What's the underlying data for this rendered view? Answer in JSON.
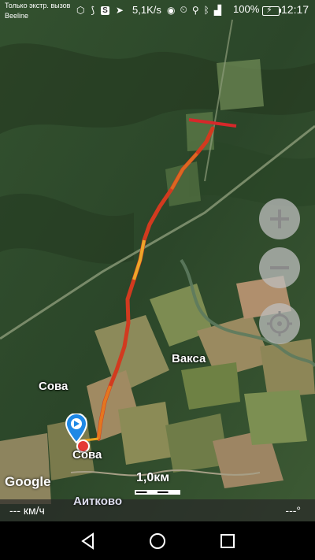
{
  "status_bar": {
    "carrier_line1": "Только экстр. вызов",
    "carrier_line2": "Beeline",
    "net_speed": "5,1K/s",
    "battery": "100%",
    "time": "12:17"
  },
  "map": {
    "places": {
      "vaksa": "Вакса",
      "sova_upper": "Сова",
      "sova_lower": "Сова",
      "aitkovo": "Аитково"
    },
    "google_logo": "Google",
    "scale_label": "1,0км",
    "zoom_in_icon": "plus-icon",
    "zoom_out_icon": "minus-icon",
    "locate_icon": "locate-icon"
  },
  "info_bar": {
    "speed": "--- км/ч",
    "heading": "---°"
  },
  "nav_bar": {
    "back_icon": "back-triangle-icon",
    "home_icon": "home-circle-icon",
    "recents_icon": "recents-square-icon"
  }
}
